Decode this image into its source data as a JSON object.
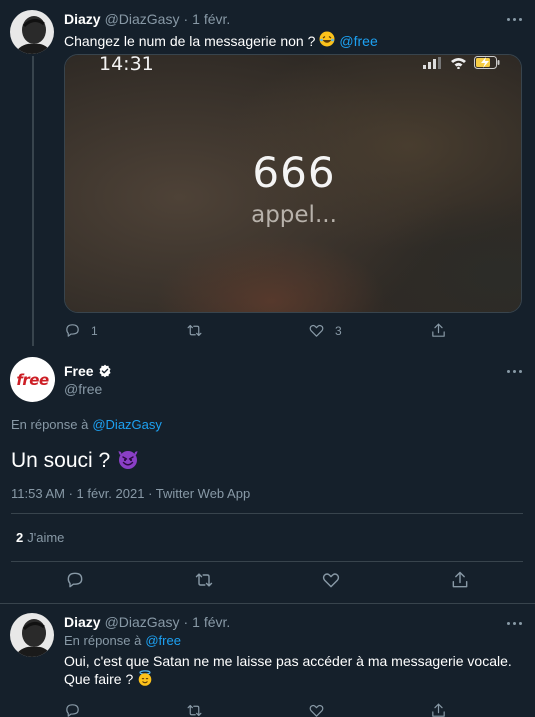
{
  "tweet1": {
    "display_name": "Diazy",
    "handle": "@DiazGasy",
    "separator": "·",
    "date": "1 févr.",
    "text": "Changez le num de la messagerie non ?",
    "mention": "@free",
    "media": {
      "time": "14:31",
      "number": "666",
      "status": "appel..."
    },
    "replies": "1",
    "likes": "3"
  },
  "tweet2": {
    "display_name": "Free",
    "handle": "@free",
    "logo_text": "free",
    "reply_prefix": "En réponse à",
    "reply_to": "@DiazGasy",
    "text": "Un souci ?",
    "timestamp": "11:53 AM · 1 févr. 2021 · Twitter Web App",
    "likes_count": "2",
    "likes_label": "J'aime"
  },
  "tweet3": {
    "display_name": "Diazy",
    "handle": "@DiazGasy",
    "separator": "·",
    "date": "1 févr.",
    "reply_prefix": "En réponse à",
    "reply_to": "@free",
    "text": "Oui, c'est que Satan ne me laisse pas accéder à ma messagerie vocale. Que faire ?"
  },
  "colors": {
    "background": "#15202b",
    "divider": "#38444d",
    "muted_text": "#8899a6",
    "link": "#1da1f2",
    "free_red": "#cd1e25"
  }
}
